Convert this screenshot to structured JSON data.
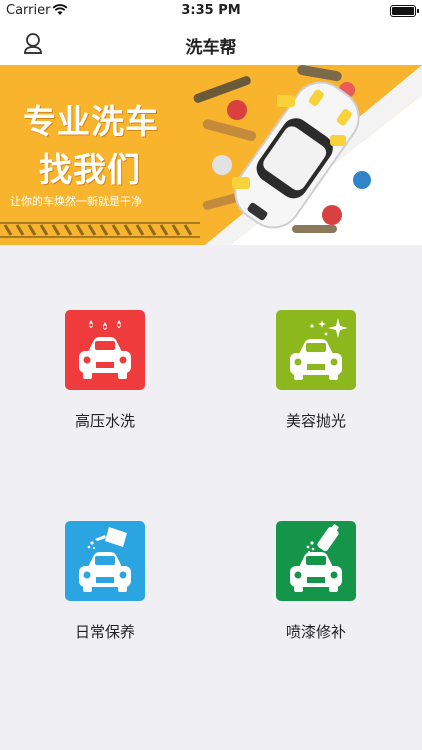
{
  "status_bar": {
    "carrier": "Carrier",
    "time": "3:35 PM",
    "battery_level": 1.0
  },
  "nav": {
    "title": "洗车帮",
    "user_icon": "user-icon"
  },
  "banner": {
    "title_line1": "专业洗车",
    "title_line2": "找我们",
    "subtitle": "让你的车焕然一新就是干净",
    "accent_color": "#f7b42c"
  },
  "services": [
    {
      "label": "高压水洗",
      "icon": "water-drops-car-icon",
      "color": "#ef3b3b"
    },
    {
      "label": "美容抛光",
      "icon": "sparkle-car-icon",
      "color": "#8cb81d"
    },
    {
      "label": "日常保养",
      "icon": "oil-can-car-icon",
      "color": "#2aa5e1"
    },
    {
      "label": "喷漆修补",
      "icon": "spray-can-car-icon",
      "color": "#15954a"
    }
  ]
}
